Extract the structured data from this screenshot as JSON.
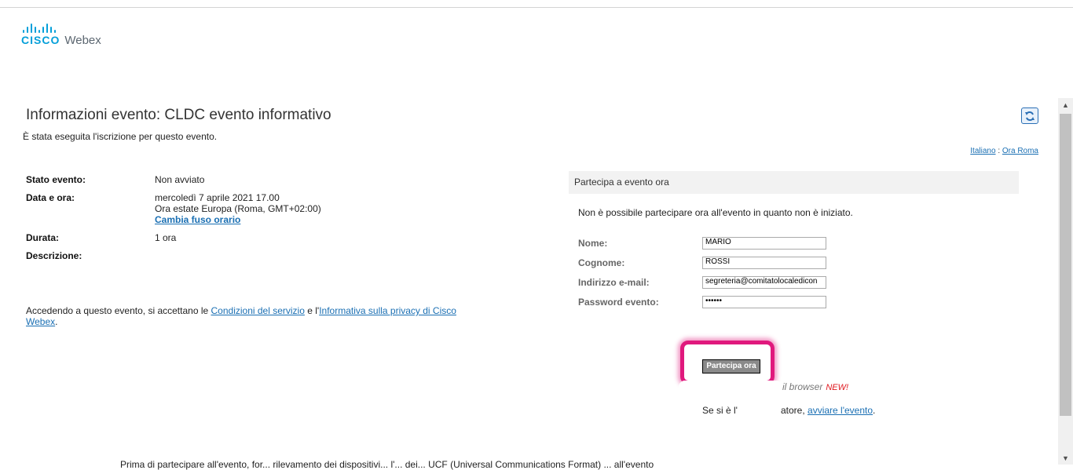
{
  "brand": {
    "cisco": "CISCO",
    "product": "Webex",
    "color": "#049fd9"
  },
  "page": {
    "title": "Informazioni evento: CLDC evento informativo",
    "subtitle": "È stata eseguita l'iscrizione per questo evento."
  },
  "lang": {
    "language": "Italiano",
    "separator": ":",
    "timezone": "Ora Roma"
  },
  "info": {
    "status_label": "Stato evento:",
    "status_value": "Non avviato",
    "date_label": "Data e ora:",
    "date_value": "mercoledì 7 aprile 2021 17.00",
    "tz_value": "Ora estate Europa (Roma, GMT+02:00)",
    "change_tz": "Cambia fuso orario",
    "duration_label": "Durata:",
    "duration_value": "1 ora",
    "description_label": "Descrizione:"
  },
  "terms": {
    "prefix": "Accedendo a questo evento, si accettano le ",
    "tos": "Condizioni del servizio",
    "middle": " e l'",
    "privacy": "Informativa sulla privacy di Cisco Webex",
    "suffix": "."
  },
  "join": {
    "header": "Partecipa a evento ora",
    "message": "Non è possibile partecipare ora all'evento in quanto non è iniziato.",
    "first_name_label": "Nome:",
    "first_name_value": "MARIO",
    "last_name_label": "Cognome:",
    "last_name_value": "ROSSI",
    "email_label": "Indirizzo e-mail:",
    "email_value": "segreteria@comitatolocaledicon",
    "password_label": "Password evento:",
    "password_value": "••••••",
    "button": "Partecipa ora",
    "browser_text": "il browser",
    "new_badge": "NEW!",
    "host_prefix": "Se si è l'",
    "host_mid": "atore, ",
    "host_link": "avviare l'evento",
    "host_suffix": "."
  },
  "footer": {
    "text": "Prima di partecipare all'evento, for... rilevamento dei dispositivi... l'... dei... UCF (Universal Communications Format) ... all'evento"
  },
  "colors": {
    "link": "#1a6fb3",
    "highlight": "#e0197d",
    "new": "#e0191f"
  }
}
